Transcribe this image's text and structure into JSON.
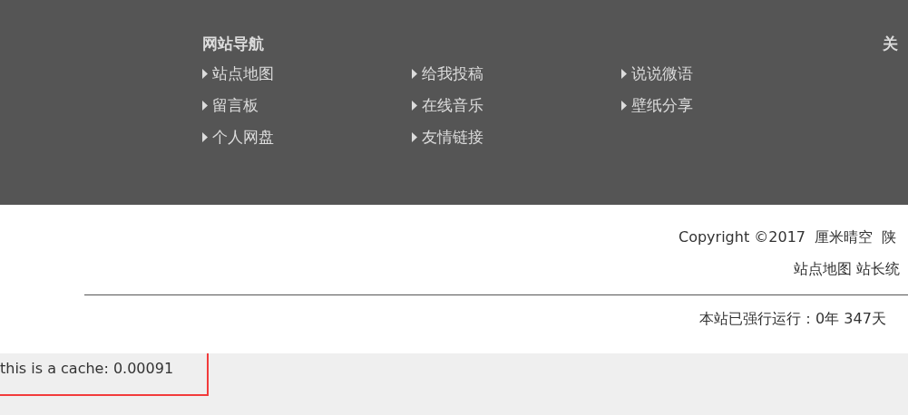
{
  "footer_nav": {
    "title": "网站导航",
    "columns": [
      {
        "links": [
          "站点地图",
          "留言板",
          "个人网盘"
        ]
      },
      {
        "links": [
          "给我投稿",
          "在线音乐",
          "友情链接"
        ]
      },
      {
        "links": [
          "说说微语",
          "壁纸分享"
        ]
      }
    ]
  },
  "about": {
    "title": "关"
  },
  "copyright": {
    "text": "Copyright ©2017  厘米晴空  陕",
    "links": [
      "站点地图",
      "站长统"
    ]
  },
  "uptime": "本站已强行运行：0年 347天",
  "cache_note": {
    "text": "this is a cache: 0.00091",
    "highlighted": true
  }
}
